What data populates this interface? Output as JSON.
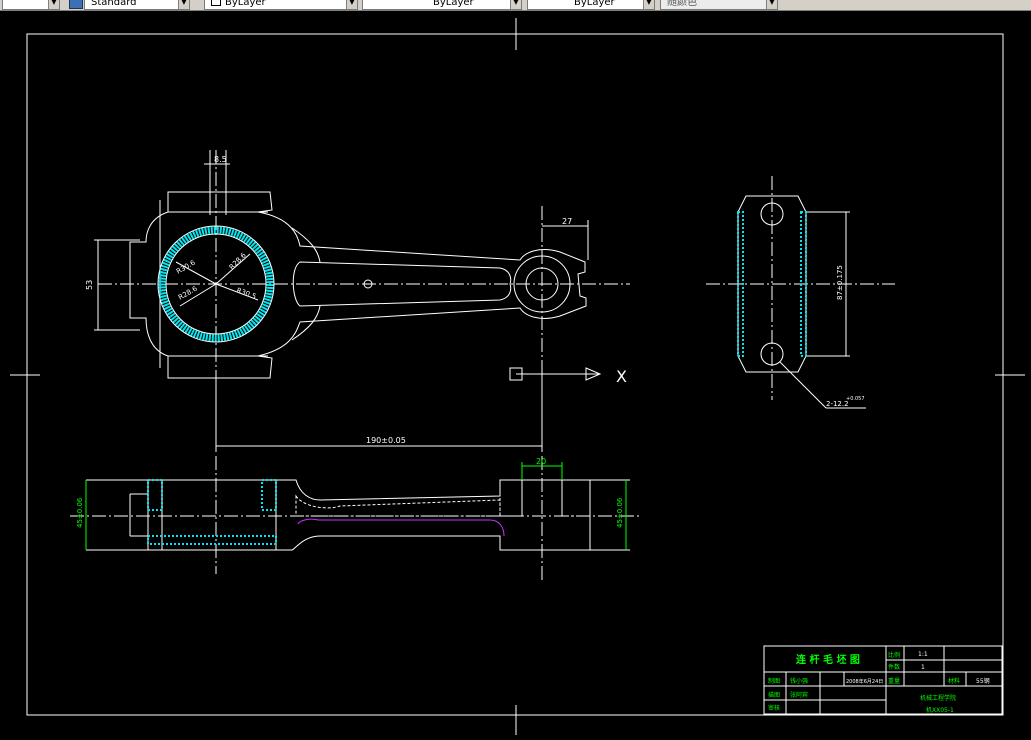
{
  "toolbar": {
    "text_style": "Standard",
    "layer": "ByLayer",
    "linetype": "ByLayer",
    "lineweight": "ByLayer",
    "plot_style": "随颜色"
  },
  "dimensions": {
    "pin_offset": "8.5",
    "big_end_height": "53",
    "r1": "R30.6",
    "r2": "R28.6",
    "r3": "R28.6",
    "r4": "R30.5",
    "small_end_width": "27",
    "center_distance": "190±0.05",
    "side_height": "87±0.175",
    "bolt_holes": "2-12.2",
    "bolt_tol": "+0.057",
    "section_width": "20",
    "section_left_h": "45±0.06",
    "section_right_h": "45±0.06",
    "ucs_x": "X"
  },
  "title_block": {
    "title": "连 杆 毛 坯 图",
    "scale_label": "比例",
    "scale_value": "1:1",
    "qty_label": "件数",
    "qty_value": "1",
    "weight_label": "重量",
    "material_label": "材料",
    "material_value": "55钢",
    "design_label": "制图",
    "design_name": "钱小强",
    "design_date": "2008年6月24日",
    "draw_label": "描图",
    "draw_name": "张阿宾",
    "check_label": "审核",
    "school": "机械工程学院",
    "class": "机XX05-1"
  },
  "colors": {
    "line": "#ffffff",
    "hatch": "#00e5ee",
    "dim": "#00ff00",
    "highlight": "#cc33ff"
  }
}
